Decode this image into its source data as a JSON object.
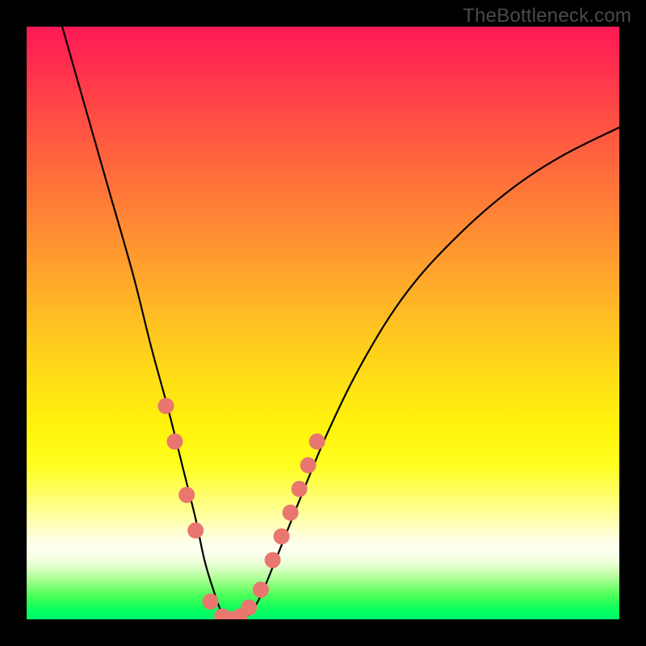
{
  "watermark": "TheBottleneck.com",
  "chart_data": {
    "type": "line",
    "title": "",
    "xlabel": "",
    "ylabel": "",
    "xlim": [
      0,
      100
    ],
    "ylim": [
      0,
      100
    ],
    "series": [
      {
        "name": "bottleneck-curve",
        "x": [
          6,
          10,
          14,
          18,
          21,
          24,
          26.5,
          28.5,
          30,
          31.5,
          33,
          34.5,
          36.5,
          39,
          42,
          46,
          51,
          57,
          64,
          72,
          81,
          90,
          100
        ],
        "values": [
          100,
          86,
          72,
          58,
          46,
          35,
          25,
          17,
          10,
          5,
          1,
          0,
          0,
          3,
          10,
          20,
          32,
          44,
          55,
          64,
          72,
          78,
          83
        ]
      }
    ],
    "markers": {
      "name": "highlighted-points",
      "color": "#e9766f",
      "x": [
        23.5,
        25.0,
        27.0,
        28.5,
        31.0,
        33.0,
        34.5,
        36.0,
        37.5,
        39.5,
        41.5,
        43.0,
        44.5,
        46.0,
        47.5,
        49.0
      ],
      "values": [
        36.0,
        30.0,
        21.0,
        15.0,
        3.0,
        0.5,
        0.0,
        0.5,
        2.0,
        5.0,
        10.0,
        14.0,
        18.0,
        22.0,
        26.0,
        30.0
      ],
      "radius": 10
    },
    "colors": {
      "curve": "#000000",
      "marker": "#e9766f",
      "gradient_top": "#ff1955",
      "gradient_mid": "#ffe015",
      "gradient_bottom": "#00ff66"
    }
  }
}
